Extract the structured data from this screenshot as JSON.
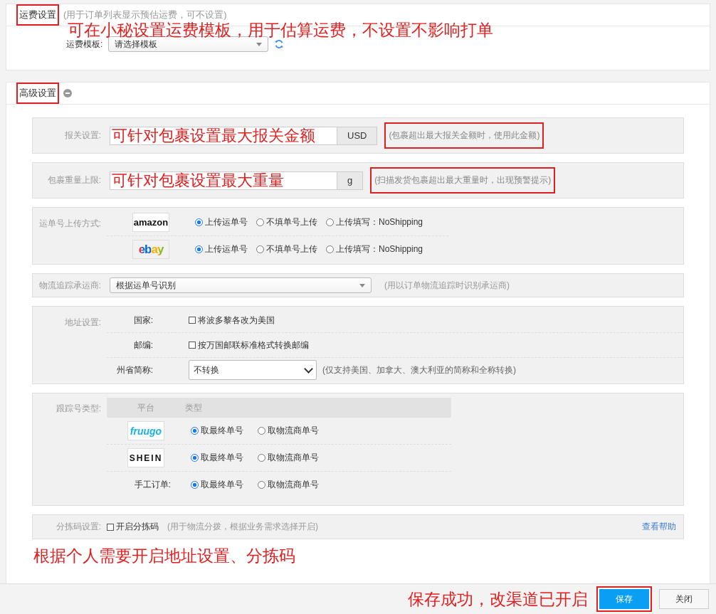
{
  "shipping_fee": {
    "title": "运费设置",
    "title_boxed": true,
    "hint": "(用于订单列表显示预估运费，可不设置)",
    "annotation": "可在小秘设置运费模板，用于估算运费，不设置不影响打单",
    "template_label": "运费模板:",
    "template_value": "请选择模板"
  },
  "advanced": {
    "title": "高级设置",
    "title_boxed": true,
    "collapsed": false,
    "customs": {
      "label": "报关设置:",
      "unit": "USD",
      "hint": "(包裹超出最大报关金额时，使用此金额)",
      "hint_boxed": true,
      "annotation": "可针对包裹设置最大报关金额"
    },
    "weight": {
      "label": "包裹重量上限:",
      "unit": "g",
      "hint": "(扫描发货包裹超出最大重量时，出现预警提示)",
      "hint_boxed": true,
      "annotation": "可针对包裹设置最大重量"
    },
    "upload": {
      "label": "运单号上传方式:",
      "platforms": [
        {
          "logo": "amazon",
          "options": [
            {
              "label": "上传运单号",
              "selected": true
            },
            {
              "label": "不填单号上传",
              "selected": false
            },
            {
              "label": "上传填写：NoShipping",
              "selected": false
            }
          ]
        },
        {
          "logo": "ebay",
          "options": [
            {
              "label": "上传运单号",
              "selected": true
            },
            {
              "label": "不填单号上传",
              "selected": false
            },
            {
              "label": "上传填写：NoShipping",
              "selected": false
            }
          ]
        }
      ]
    },
    "carrier": {
      "label": "物流追踪承运商:",
      "value": "根据运单号识别",
      "hint": "(用以订单物流追踪时识别承运商)"
    },
    "address": {
      "label": "地址设置:",
      "rows": [
        {
          "kind": "checkbox",
          "label": "国家:",
          "text": "将波多黎各改为美国",
          "checked": false
        },
        {
          "kind": "checkbox",
          "label": "邮编:",
          "text": "按万国邮联标准格式转换邮编",
          "checked": false
        },
        {
          "kind": "select",
          "label": "州省简称:",
          "value": "不转换",
          "hint": "(仅支持美国、加拿大、澳大利亚的简称和全称转换)"
        }
      ]
    },
    "tracking": {
      "label": "跟踪号类型:",
      "columns": [
        "平台",
        "类型"
      ],
      "rows": [
        {
          "kind": "logo",
          "logo": "fruugo",
          "options": [
            {
              "label": "取最终单号",
              "selected": true
            },
            {
              "label": "取物流商单号",
              "selected": false
            }
          ]
        },
        {
          "kind": "logo",
          "logo": "SHEIN",
          "options": [
            {
              "label": "取最终单号",
              "selected": true
            },
            {
              "label": "取物流商单号",
              "selected": false
            }
          ]
        },
        {
          "kind": "text",
          "label": "手工订单:",
          "options": [
            {
              "label": "取最终单号",
              "selected": true
            },
            {
              "label": "取物流商单号",
              "selected": false
            }
          ]
        }
      ]
    },
    "sorting": {
      "label": "分拣码设置:",
      "text": "开启分拣码",
      "checked": false,
      "hint": "(用于物流分拨，根据业务需求选择开启)",
      "help": "查看帮助"
    },
    "annotation": "根据个人需要开启地址设置、分拣码"
  },
  "footer": {
    "annotation": "保存成功，改渠道已开启",
    "buttons": [
      {
        "label": "保存",
        "kind": "primary",
        "boxed": true
      },
      {
        "label": "关闭",
        "kind": "default",
        "boxed": false
      }
    ]
  }
}
